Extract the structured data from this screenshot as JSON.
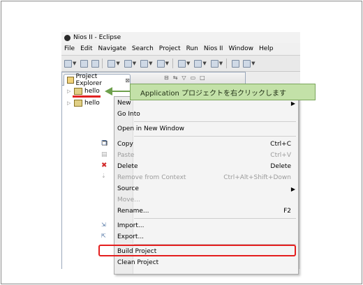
{
  "window": {
    "title": "Nios II - Eclipse"
  },
  "menubar": [
    "File",
    "Edit",
    "Navigate",
    "Search",
    "Project",
    "Run",
    "Nios II",
    "Window",
    "Help"
  ],
  "panel": {
    "tab_label": "Project Explorer",
    "tab_close": "⊠"
  },
  "tree": {
    "items": [
      "hello",
      "hello"
    ]
  },
  "callout": {
    "text": "Application プロジェクトを右クリックします",
    "color": "#c3e1a8"
  },
  "context_menu": {
    "new": "New",
    "go_into": "Go Into",
    "open_new_window": "Open in New Window",
    "copy": "Copy",
    "copy_key": "Ctrl+C",
    "paste": "Paste",
    "paste_key": "Ctrl+V",
    "delete": "Delete",
    "delete_key": "Delete",
    "remove_context": "Remove from Context",
    "remove_context_key": "Ctrl+Alt+Shift+Down",
    "source": "Source",
    "move": "Move...",
    "rename": "Rename...",
    "rename_key": "F2",
    "import": "Import...",
    "export": "Export...",
    "build_project": "Build Project",
    "clean_project": "Clean Project"
  },
  "highlight_color": "#e41e1e"
}
